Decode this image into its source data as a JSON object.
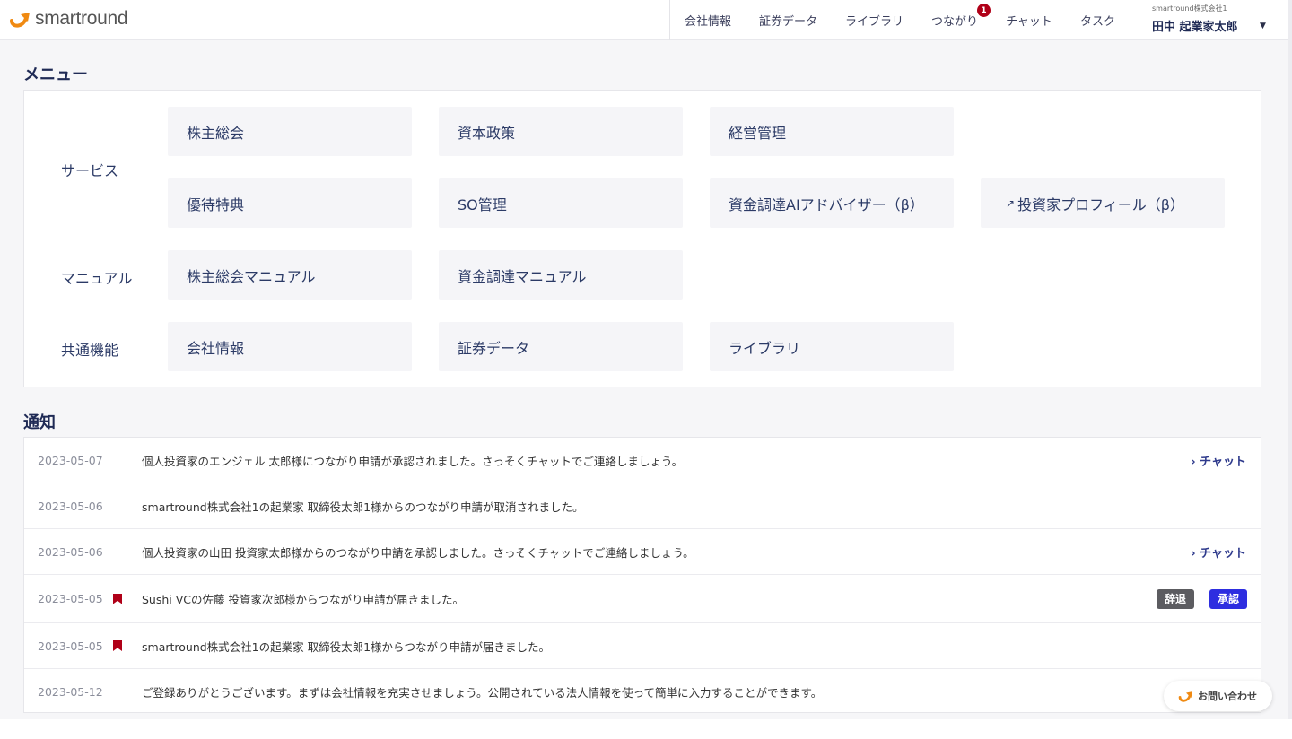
{
  "header": {
    "logo": "smartround",
    "nav": [
      "会社情報",
      "証券データ",
      "ライブラリ",
      "つながり",
      "チャット",
      "タスク"
    ],
    "connections_badge": "1",
    "company": "smartround株式会社1",
    "user_name": "田中 起業家太郎"
  },
  "menu": {
    "title": "メニュー",
    "rows": [
      {
        "label": "サービス",
        "items": [
          "株主総会",
          "資本政策",
          "経営管理",
          "優待特典",
          "SO管理",
          "資金調達AIアドバイザー（β）",
          "投資家プロフィール（β）"
        ]
      },
      {
        "label": "マニュアル",
        "items": [
          "株主総会マニュアル",
          "資金調達マニュアル"
        ]
      },
      {
        "label": "共通機能",
        "items": [
          "会社情報",
          "証券データ",
          "ライブラリ"
        ]
      }
    ]
  },
  "notifications": {
    "title": "通知",
    "items": [
      {
        "date": "2023-05-07",
        "text": "個人投資家のエンジェル 太郎様につながり申請が承認されました。さっそくチャットでご連絡しましょう。",
        "action": "› チャット"
      },
      {
        "date": "2023-05-06",
        "text": "smartround株式会社1の起業家 取締役太郎1様からのつながり申請が取消されました。"
      },
      {
        "date": "2023-05-06",
        "text": "個人投資家の山田 投資家太郎様からのつながり申請を承認しました。さっそくチャットでご連絡しましょう。",
        "action": "› チャット"
      },
      {
        "date": "2023-05-05",
        "text": "Sushi VCの佐藤 投資家次郎様からつながり申請が届きました。",
        "decline": "辞退",
        "approve": "承認"
      },
      {
        "date": "2023-05-05",
        "text": "smartround株式会社1の起業家 取締役太郎1様からつながり申請が届きました。"
      },
      {
        "date": "2023-05-12",
        "text": "ご登録ありがとうございます。まずは会社情報を充実させましょう。公開されている法人情報を使って簡単に入力することができます。"
      }
    ]
  },
  "contact": "お問い合わせ",
  "colors": {
    "brand": "#f08a12",
    "navy": "#1f2a55",
    "approve": "#2e2ee0",
    "flag": "#b00018"
  }
}
